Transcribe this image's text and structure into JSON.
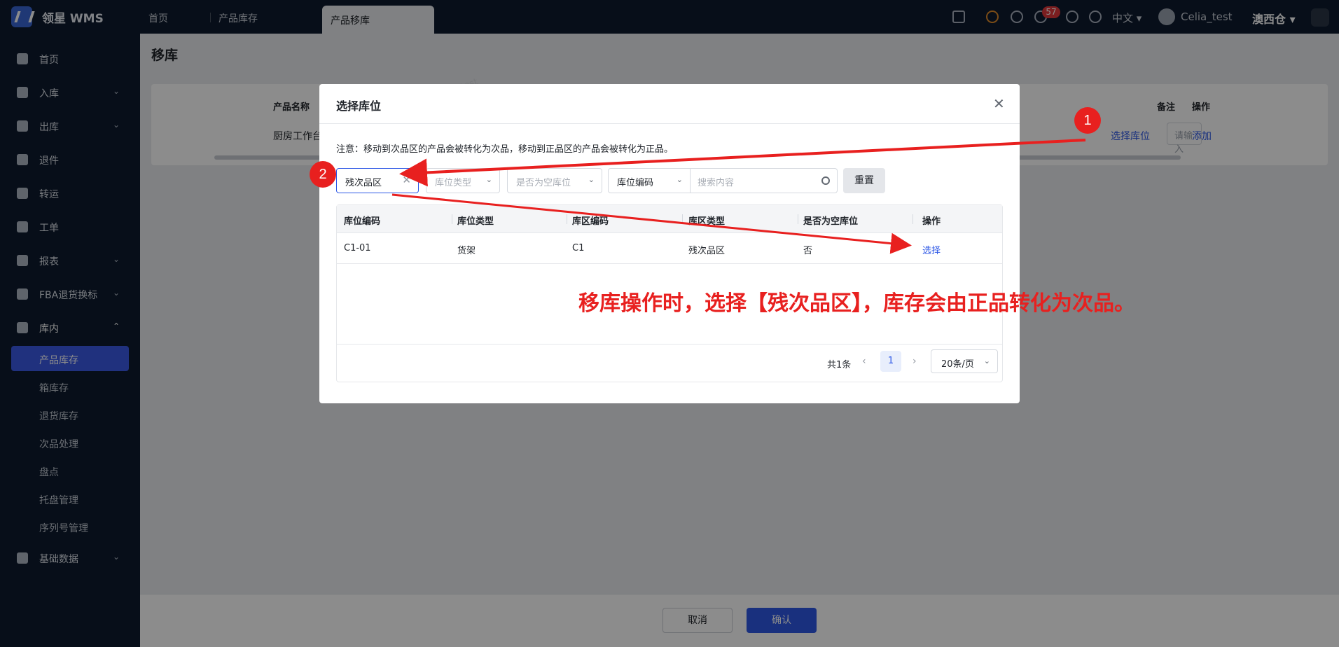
{
  "topbar": {
    "brand": "领星 WMS",
    "tabs": [
      "首页",
      "产品库存",
      "产品移库"
    ],
    "notification_count": "57",
    "language": "中文",
    "username": "Celia_test",
    "warehouse": "澳西仓"
  },
  "sidebar": {
    "items": [
      {
        "label": "首页",
        "icon": "home-icon"
      },
      {
        "label": "入库",
        "icon": "inbound-icon"
      },
      {
        "label": "出库",
        "icon": "outbound-icon"
      },
      {
        "label": "退件",
        "icon": "return-icon"
      },
      {
        "label": "转运",
        "icon": "transfer-icon"
      },
      {
        "label": "工单",
        "icon": "workorder-icon"
      },
      {
        "label": "报表",
        "icon": "report-icon"
      },
      {
        "label": "FBA退货换标",
        "icon": "fba-icon"
      },
      {
        "label": "库内",
        "icon": "warehouse-icon"
      },
      {
        "label": "基础数据",
        "icon": "data-icon"
      }
    ],
    "sub_items": [
      "产品库存",
      "箱库存",
      "退货库存",
      "次品处理",
      "盘点",
      "托盘管理",
      "序列号管理"
    ]
  },
  "page": {
    "title": "移库",
    "columns": {
      "product_name": "产品名称",
      "remark": "备注",
      "action": "操作"
    },
    "row": {
      "product_name": "厨房工作台",
      "select_location": "选择库位",
      "remark_placeholder": "请输入",
      "add": "添加"
    },
    "cancel": "取消",
    "confirm": "确认"
  },
  "modal": {
    "title": "选择库位",
    "notice": "注意：移动到次品区的产品会被转化为次品，移动到正品区的产品会被转化为正品。",
    "filters": {
      "zone_type": "残次品区",
      "location_type_placeholder": "库位类型",
      "empty_placeholder": "是否为空库位",
      "search_field": "库位编码",
      "search_placeholder": "搜索内容",
      "reset": "重置"
    },
    "table": {
      "headers": [
        "库位编码",
        "库位类型",
        "库区编码",
        "库区类型",
        "是否为空库位",
        "操作"
      ],
      "rows": [
        {
          "location_code": "C1-01",
          "location_type": "货架",
          "zone_code": "C1",
          "zone_type": "残次品区",
          "is_empty": "否",
          "action": "选择"
        }
      ]
    },
    "pagination": {
      "total": "共1条",
      "page": "1",
      "page_size": "20条/页"
    }
  },
  "annotations": {
    "marker1": "1",
    "marker2": "2",
    "note": "移库操作时，选择【残次品区】，库存会由正品转化为次品。",
    "color": "#e8201f"
  }
}
